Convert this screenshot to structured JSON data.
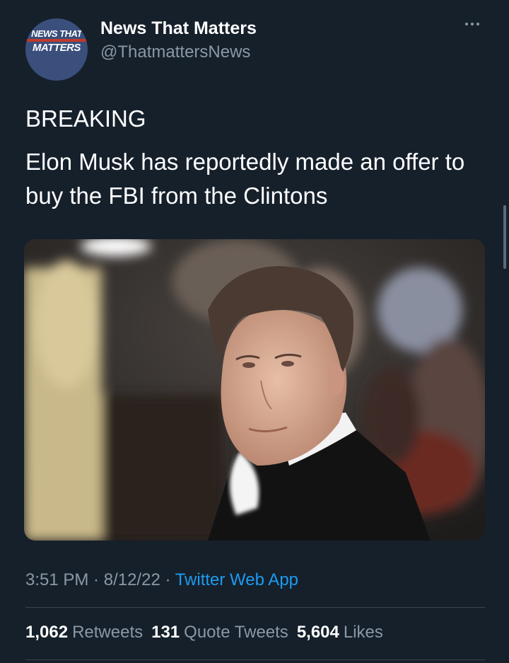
{
  "author": {
    "avatar_text_line1": "NEWS THAT",
    "avatar_text_line2": "MATTERS",
    "display_name": "News That Matters",
    "handle": "@ThatmattersNews"
  },
  "tweet": {
    "heading": "BREAKING",
    "body": "Elon Musk has reportedly made an offer to buy the FBI from the Clintons"
  },
  "meta": {
    "time": "3:51 PM",
    "separator": " · ",
    "date": "8/12/22",
    "source": "Twitter Web App"
  },
  "stats": {
    "retweets_count": "1,062",
    "retweets_label": "Retweets",
    "quotes_count": "131",
    "quotes_label": "Quote Tweets",
    "likes_count": "5,604",
    "likes_label": "Likes"
  },
  "icons": {
    "more": "more-horizontal-icon"
  },
  "colors": {
    "background": "#15202b",
    "secondary_text": "#8b98a5",
    "link": "#1d9bf0",
    "avatar_bg": "#3a4f7c"
  }
}
